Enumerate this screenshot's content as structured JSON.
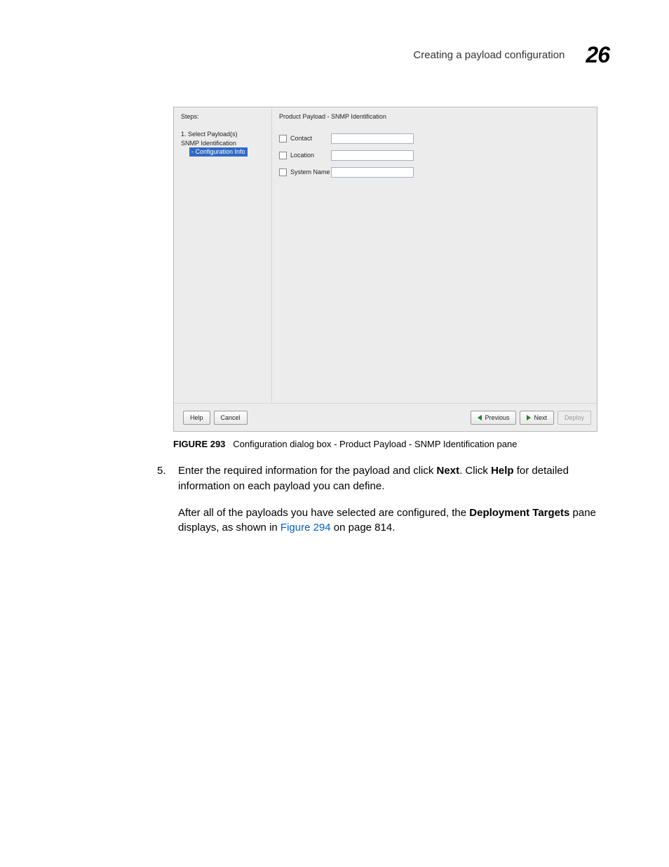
{
  "header": {
    "title": "Creating a payload configuration",
    "chapter": "26"
  },
  "dialog": {
    "steps_title": "Steps:",
    "step1": "1. Select Payload(s)",
    "step_sub1": "SNMP Identification",
    "step_sub2": "- Configuration Info",
    "pane_title": "Product Payload - SNMP Identification",
    "rows": {
      "contact": "Contact",
      "location": "Location",
      "system_name": "System Name"
    },
    "buttons": {
      "help": "Help",
      "cancel": "Cancel",
      "previous": "Previous",
      "next": "Next",
      "deploy": "Deploy"
    }
  },
  "figure": {
    "label": "FIGURE 293",
    "caption": "Configuration dialog box - Product Payload - SNMP Identification pane"
  },
  "step5": {
    "num": "5.",
    "pre": "Enter the required information for the payload and click ",
    "next": "Next",
    "mid": ". Click ",
    "help": "Help",
    "post": " for detailed information on each payload you can define."
  },
  "para": {
    "pre": "After all of the payloads you have selected are configured, the ",
    "bold": "Deployment Targets",
    "mid": " pane displays, as shown in ",
    "link": "Figure 294",
    "post": " on page 814."
  }
}
